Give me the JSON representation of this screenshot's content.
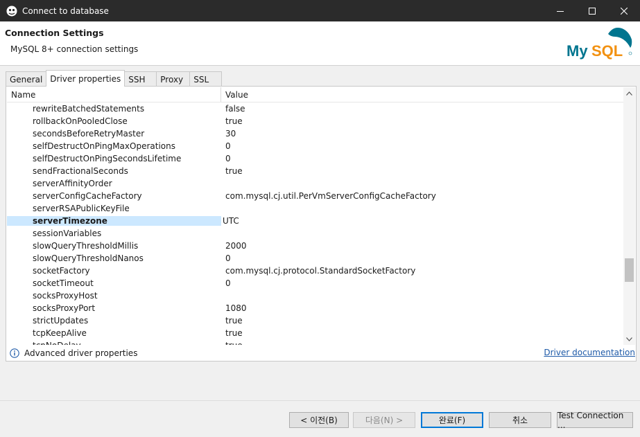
{
  "window": {
    "title": "Connect to database"
  },
  "header": {
    "title": "Connection Settings",
    "subtitle": "MySQL 8+ connection settings",
    "logo_text": "MySQL"
  },
  "tabs": [
    {
      "label": "General",
      "active": false
    },
    {
      "label": "Driver properties",
      "active": true
    },
    {
      "label": "SSH",
      "active": false
    },
    {
      "label": "Proxy",
      "active": false
    },
    {
      "label": "SSL",
      "active": false
    }
  ],
  "grid": {
    "columns": [
      "Name",
      "Value"
    ],
    "rows": [
      {
        "name": "rewriteBatchedStatements",
        "value": "false"
      },
      {
        "name": "rollbackOnPooledClose",
        "value": "true"
      },
      {
        "name": "secondsBeforeRetryMaster",
        "value": "30"
      },
      {
        "name": "selfDestructOnPingMaxOperations",
        "value": "0"
      },
      {
        "name": "selfDestructOnPingSecondsLifetime",
        "value": "0"
      },
      {
        "name": "sendFractionalSeconds",
        "value": "true"
      },
      {
        "name": "serverAffinityOrder",
        "value": ""
      },
      {
        "name": "serverConfigCacheFactory",
        "value": "com.mysql.cj.util.PerVmServerConfigCacheFactory"
      },
      {
        "name": "serverRSAPublicKeyFile",
        "value": ""
      },
      {
        "name": "serverTimezone",
        "value": "UTC",
        "selected": true
      },
      {
        "name": "sessionVariables",
        "value": ""
      },
      {
        "name": "slowQueryThresholdMillis",
        "value": "2000"
      },
      {
        "name": "slowQueryThresholdNanos",
        "value": "0"
      },
      {
        "name": "socketFactory",
        "value": "com.mysql.cj.protocol.StandardSocketFactory"
      },
      {
        "name": "socketTimeout",
        "value": "0"
      },
      {
        "name": "socksProxyHost",
        "value": ""
      },
      {
        "name": "socksProxyPort",
        "value": "1080"
      },
      {
        "name": "strictUpdates",
        "value": "true"
      },
      {
        "name": "tcpKeepAlive",
        "value": "true"
      },
      {
        "name": "tcpNoDelay",
        "value": "true"
      }
    ]
  },
  "footer": {
    "advanced_label": "Advanced driver properties",
    "doc_link": "Driver documentation"
  },
  "buttons": {
    "back": "< 이전(B)",
    "next": "다음(N) >",
    "finish": "완료(F)",
    "cancel": "취소",
    "test": "Test Connection ..."
  },
  "colors": {
    "titlebar": "#2b2b2b",
    "selection": "#cce8ff",
    "link": "#1e5aa8",
    "logo_blue": "#00758f",
    "logo_orange": "#f29111"
  }
}
